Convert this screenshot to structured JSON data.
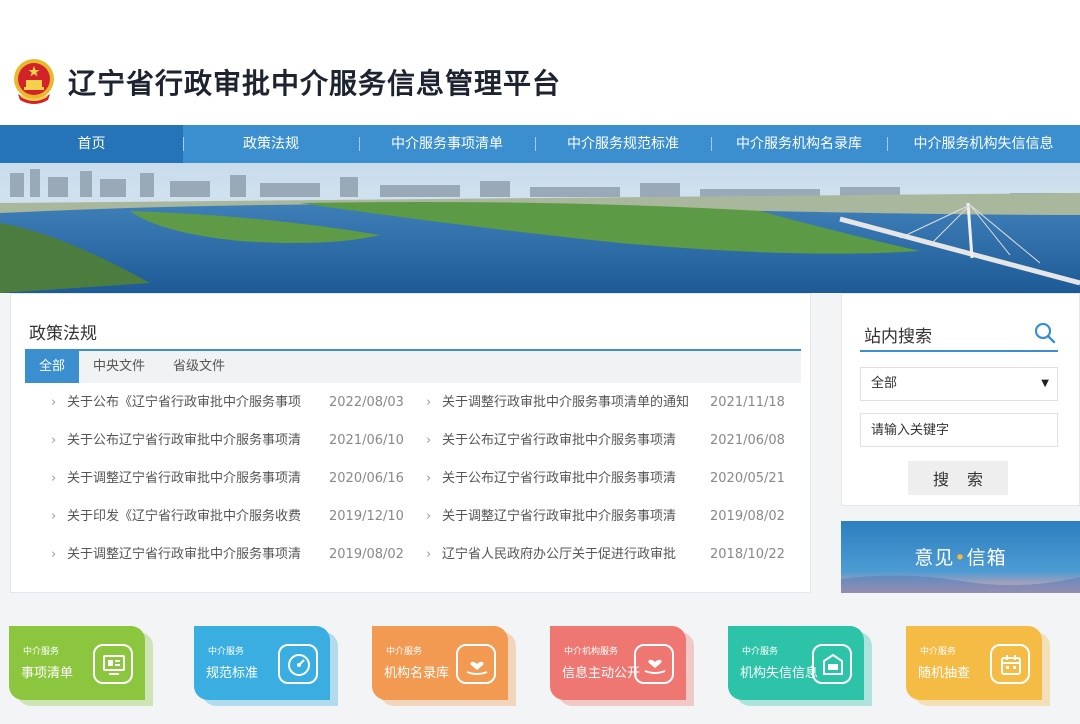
{
  "header": {
    "title": "辽宁省行政审批中介服务信息管理平台",
    "emblem": "national-emblem"
  },
  "nav": {
    "items": [
      {
        "label": "首页"
      },
      {
        "label": "政策法规"
      },
      {
        "label": "中介服务事项清单"
      },
      {
        "label": "中介服务规范标准"
      },
      {
        "label": "中介服务机构名录库"
      },
      {
        "label": "中介服务机构失信信息"
      }
    ]
  },
  "policy": {
    "title": "政策法规",
    "tabs": [
      {
        "label": "全部"
      },
      {
        "label": "中央文件"
      },
      {
        "label": "省级文件"
      }
    ],
    "left": [
      {
        "title": "关于公布《辽宁省行政审批中介服务事项",
        "date": "2022/08/03"
      },
      {
        "title": "关于公布辽宁省行政审批中介服务事项清",
        "date": "2021/06/10"
      },
      {
        "title": "关于调整辽宁省行政审批中介服务事项清",
        "date": "2020/06/16"
      },
      {
        "title": "关于印发《辽宁省行政审批中介服务收费",
        "date": "2019/12/10"
      },
      {
        "title": "关于调整辽宁省行政审批中介服务事项清",
        "date": "2019/08/02"
      }
    ],
    "right": [
      {
        "title": "关于调整行政审批中介服务事项清单的通知",
        "date": "2021/11/18"
      },
      {
        "title": "关于公布辽宁省行政审批中介服务事项清",
        "date": "2021/06/08"
      },
      {
        "title": "关于公布辽宁省行政审批中介服务事项清",
        "date": "2020/05/21"
      },
      {
        "title": "关于调整辽宁省行政审批中介服务事项清",
        "date": "2019/08/02"
      },
      {
        "title": "辽宁省人民政府办公厅关于促进行政审批",
        "date": "2018/10/22"
      }
    ],
    "arrow": "›"
  },
  "search": {
    "title": "站内搜索",
    "scope": "全部",
    "caret": "▼",
    "placeholder": "请输入关键字",
    "button": "搜索"
  },
  "mailbox": {
    "part1": "意见",
    "dot": "•",
    "part2": "信箱"
  },
  "tiles": [
    {
      "small": "中介服务",
      "big": "事项清单",
      "color": "#8cc63f",
      "icon": "list-screen-icon"
    },
    {
      "small": "中介服务",
      "big": "规范标准",
      "color": "#3aaee0",
      "icon": "gauge-icon"
    },
    {
      "small": "中介服务",
      "big": "机构名录库",
      "color": "#f29a52",
      "icon": "hand-heart-icon"
    },
    {
      "small": "中介机构服务",
      "big": "信息主动公开",
      "color": "#ee7772",
      "icon": "hand-heart-icon"
    },
    {
      "small": "中介服务",
      "big": "机构失信信息",
      "color": "#2cc3a8",
      "icon": "inbox-icon"
    },
    {
      "small": "中介服务",
      "big": "随机抽查",
      "color": "#f4bb45",
      "icon": "calendar-icon"
    }
  ]
}
